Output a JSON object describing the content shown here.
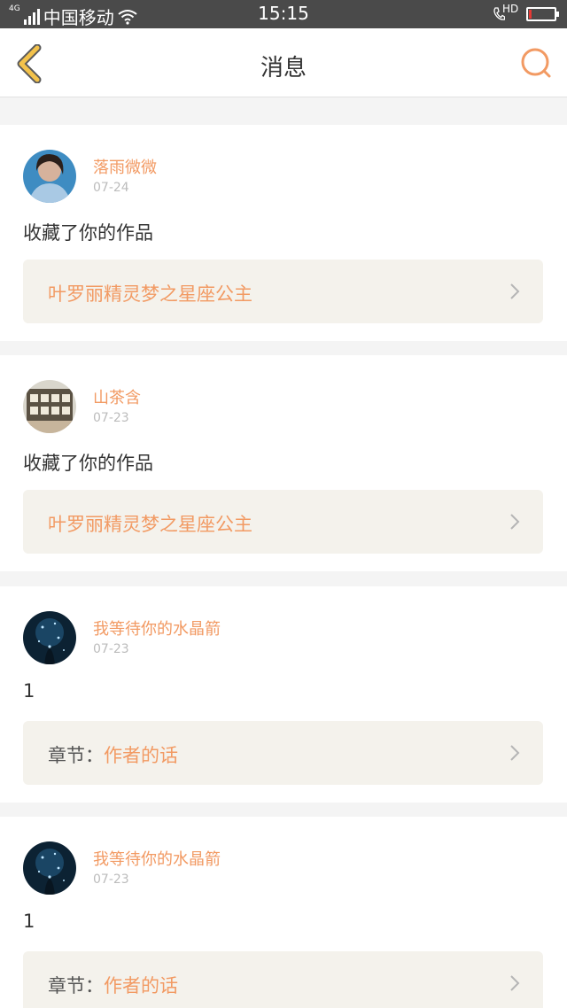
{
  "status_bar": {
    "carrier": "中国移动",
    "network": "4G",
    "time": "15:15",
    "hd_label": "HD",
    "battery_level": 0.1
  },
  "header": {
    "title": "消息"
  },
  "messages": [
    {
      "user": "落雨微微",
      "date": "07-24",
      "action": "收藏了你的作品",
      "link_prefix": "",
      "link_text": "叶罗丽精灵梦之星座公主"
    },
    {
      "user": "山茶含",
      "date": "07-23",
      "action": "收藏了你的作品",
      "link_prefix": "",
      "link_text": "叶罗丽精灵梦之星座公主"
    },
    {
      "user": "我等待你的水晶箭",
      "date": "07-23",
      "action": "1",
      "link_prefix": "章节：",
      "link_text": "作者的话"
    },
    {
      "user": "我等待你的水晶箭",
      "date": "07-23",
      "action": "1",
      "link_prefix": "章节：",
      "link_text": "作者的话"
    }
  ],
  "colors": {
    "accent": "#f29a63",
    "back_icon": "#f3c24b",
    "link_bg": "#f4f2ec",
    "page_bg": "#f4f4f4"
  }
}
